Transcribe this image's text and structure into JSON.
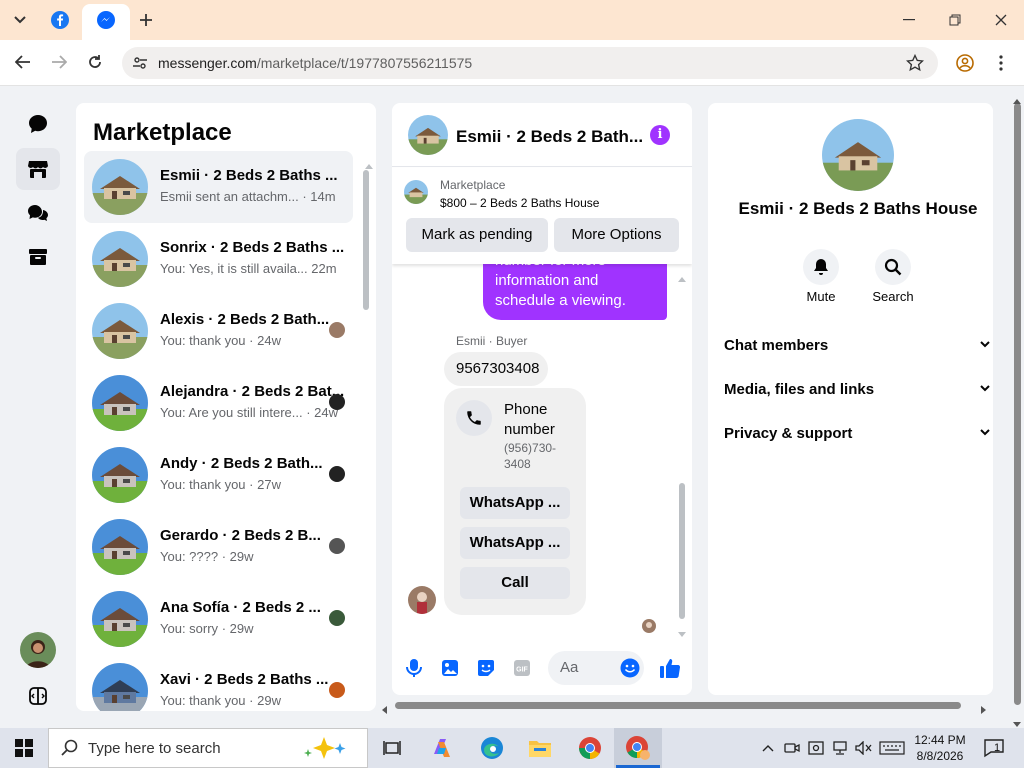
{
  "browser": {
    "url_host": "messenger.com",
    "url_path": "/marketplace/t/1977807556211575"
  },
  "list": {
    "title": "Marketplace",
    "conversations": [
      {
        "name": "Esmii · 2 Beds 2 Baths ...",
        "preview": "Esmii sent an attachm...",
        "time": "· 14m",
        "selected": true
      },
      {
        "name": "Sonrix · 2 Beds 2 Baths ...",
        "preview": "You: Yes, it is still availa...",
        "time": "22m"
      },
      {
        "name": "Alexis · 2 Beds 2 Bath...",
        "preview": "You: thank you",
        "time": "· 24w"
      },
      {
        "name": "Alejandra · 2 Beds 2 Bat...",
        "preview": "You: Are you still intere...",
        "time": "· 24w"
      },
      {
        "name": "Andy · 2 Beds 2 Bath...",
        "preview": "You: thank you",
        "time": "· 27w"
      },
      {
        "name": "Gerardo · 2 Beds 2 B...",
        "preview": "You: ????",
        "time": "· 29w"
      },
      {
        "name": "Ana Sofía · 2 Beds 2 ...",
        "preview": "You: sorry",
        "time": "· 29w"
      },
      {
        "name": "Xavi · 2 Beds 2 Baths ...",
        "preview": "You: thank you",
        "time": "· 29w"
      }
    ]
  },
  "chat": {
    "title": "Esmii · 2 Beds 2 Bath...",
    "marketplace_label": "Marketplace",
    "listing": "$800 – 2 Beds 2 Baths House",
    "mark_pending": "Mark as pending",
    "more_options": "More Options",
    "outgoing_text": "number for more information and schedule a viewing.",
    "sender_label": "Esmii · Buyer",
    "number_message": "9567303408",
    "phone_card_title": "Phone number",
    "phone_card_number": "(956)730-3408",
    "whatsapp_1": "WhatsApp ...",
    "whatsapp_2": "WhatsApp ...",
    "call": "Call",
    "composer_placeholder": "Aa"
  },
  "info": {
    "name": "Esmii · 2 Beds 2 Baths House",
    "mute": "Mute",
    "search": "Search",
    "rows": [
      "Chat members",
      "Media, files and links",
      "Privacy & support"
    ]
  },
  "taskbar": {
    "search_placeholder": "Type here to search",
    "time": "12:44 PM",
    "date": "8/8/2026",
    "notifications": "1"
  },
  "colors": {
    "accent": "#a033ff",
    "messenger_blue": "#0866ff"
  }
}
